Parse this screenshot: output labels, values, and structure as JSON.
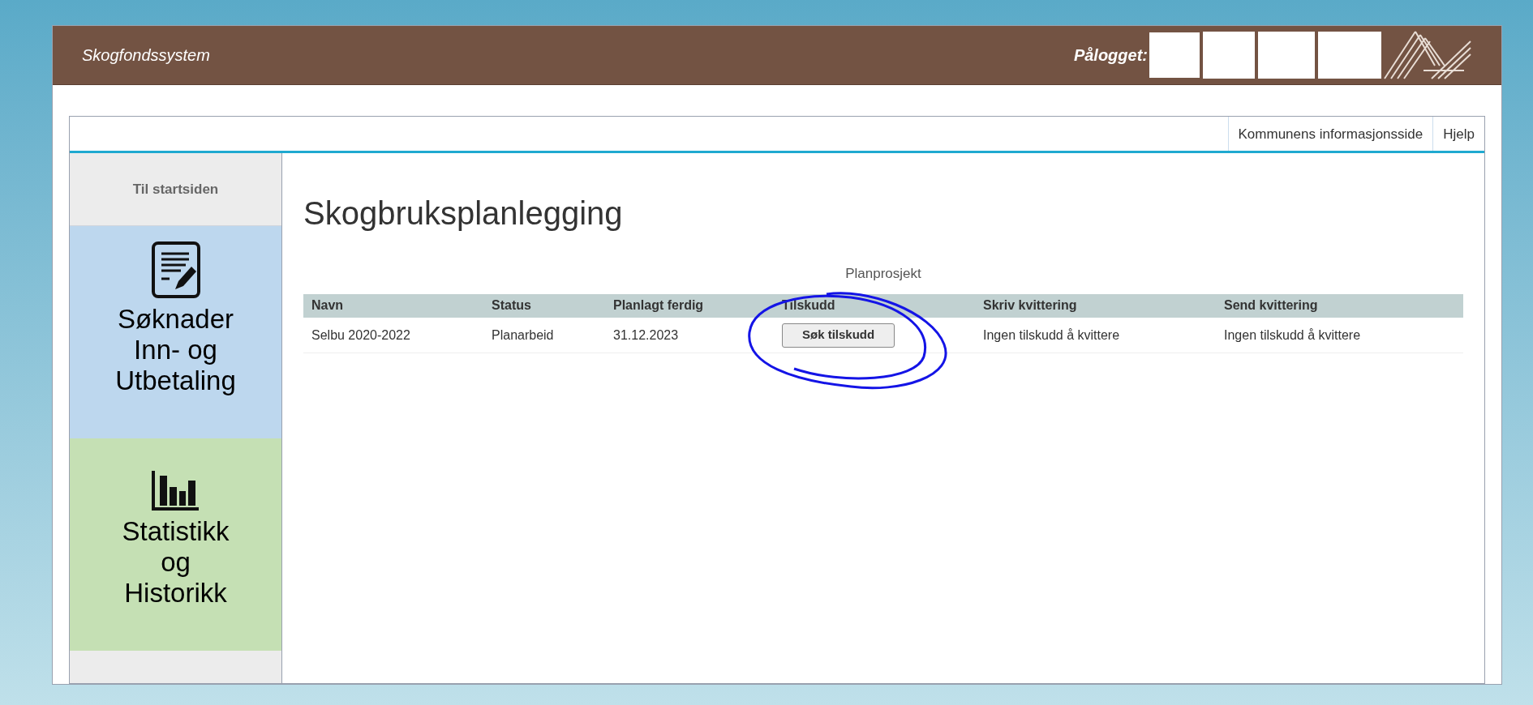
{
  "header": {
    "title": "Skogfondssystem",
    "login_label": "Pålogget:"
  },
  "top_links": [
    {
      "label": "Kommunens informasjonsside"
    },
    {
      "label": "Hjelp"
    }
  ],
  "sidebar": {
    "home": "Til startsiden",
    "tiles": [
      {
        "kind": "document",
        "lines": [
          "Søknader",
          "Inn- og",
          "Utbetaling"
        ],
        "color": "#bdd7ee"
      },
      {
        "kind": "chart",
        "lines": [
          "Statistikk",
          "og",
          "Historikk"
        ],
        "color": "#c5e0b4"
      }
    ]
  },
  "page_title": "Skogbruksplanlegging",
  "table": {
    "caption": "Planprosjekt",
    "columns": [
      "Navn",
      "Status",
      "Planlagt ferdig",
      "Tilskudd",
      "Skriv kvittering",
      "Send kvittering"
    ],
    "rows": [
      {
        "cells": [
          "Selbu 2020-2022",
          "Planarbeid",
          "31.12.2023",
          {
            "kind": "button",
            "label": "Søk tilskudd"
          },
          "Ingen tilskudd å kvittere",
          "Ingen tilskudd å kvittere"
        ]
      }
    ]
  }
}
